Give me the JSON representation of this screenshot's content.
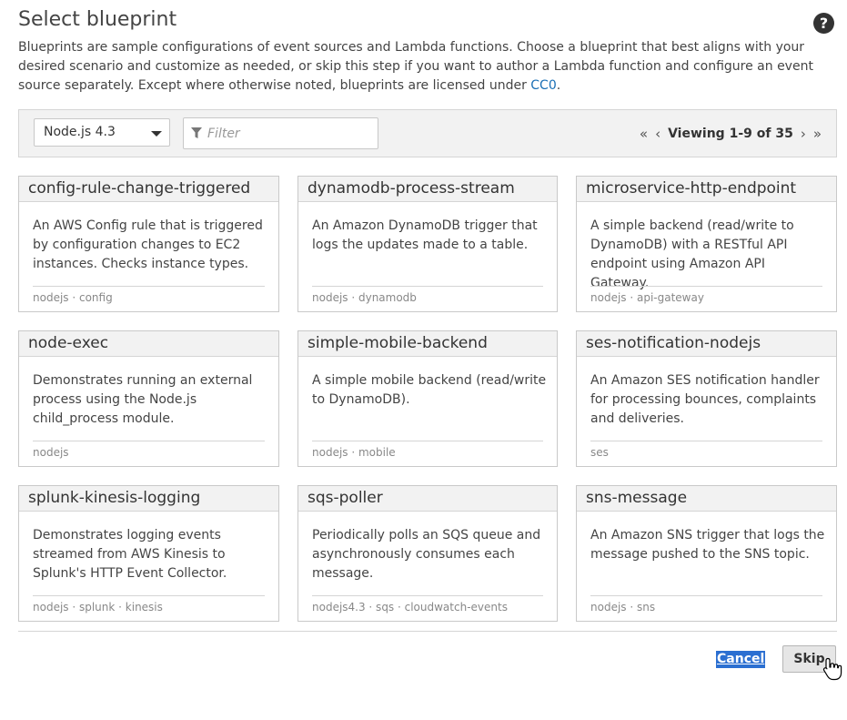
{
  "header": {
    "title": "Select blueprint",
    "help_icon": "question-circle-icon"
  },
  "description": {
    "text_before_link": "Blueprints are sample configurations of event sources and Lambda functions. Choose a blueprint that best aligns with your desired scenario and customize as needed, or skip this step if you want to author a Lambda function and configure an event source separately. Except where otherwise noted, blueprints are licensed under ",
    "link_text": "CC0",
    "text_after_link": "."
  },
  "toolbar": {
    "runtime_selected": "Node.js 4.3",
    "filter_placeholder": "Filter",
    "filter_value": "",
    "pagination": {
      "first_icon": "«",
      "prev_icon": "‹",
      "viewing": "Viewing 1-9 of 35",
      "next_icon": "›",
      "last_icon": "»"
    }
  },
  "blueprints": [
    {
      "name": "config-rule-change-triggered",
      "description": "An AWS Config rule that is triggered by configuration changes to EC2 instances. Checks instance types.",
      "tags": "nodejs · config"
    },
    {
      "name": "dynamodb-process-stream",
      "description": "An Amazon DynamoDB trigger that logs the updates made to a table.",
      "tags": "nodejs · dynamodb"
    },
    {
      "name": "microservice-http-endpoint",
      "description": "A simple backend (read/write to DynamoDB) with a RESTful API endpoint using Amazon API Gateway.",
      "tags": "nodejs · api-gateway"
    },
    {
      "name": "node-exec",
      "description": "Demonstrates running an external process using the Node.js child_process module.",
      "tags": "nodejs"
    },
    {
      "name": "simple-mobile-backend",
      "description": "A simple mobile backend (read/write to DynamoDB).",
      "tags": "nodejs · mobile"
    },
    {
      "name": "ses-notification-nodejs",
      "description": "An Amazon SES notification handler for processing bounces, complaints and deliveries.",
      "tags": "ses"
    },
    {
      "name": "splunk-kinesis-logging",
      "description": "Demonstrates logging events streamed from AWS Kinesis to Splunk's HTTP Event Collector.",
      "tags": "nodejs · splunk · kinesis"
    },
    {
      "name": "sqs-poller",
      "description": "Periodically polls an SQS queue and asynchronously consumes each message.",
      "tags": "nodejs4.3 · sqs · cloudwatch-events"
    },
    {
      "name": "sns-message",
      "description": "An Amazon SNS trigger that logs the message pushed to the SNS topic.",
      "tags": "nodejs · sns"
    }
  ],
  "footer": {
    "cancel_label": "Cancel",
    "skip_label": "Skip"
  }
}
